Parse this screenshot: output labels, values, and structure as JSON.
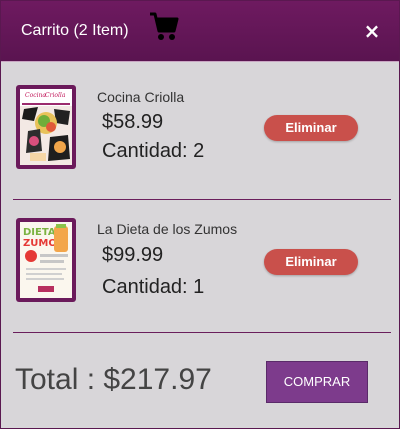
{
  "header": {
    "title": "Carrito (2 Item)",
    "cart_icon": "shopping-cart-icon",
    "close_icon": "close-icon",
    "close_glyph": "×"
  },
  "items": [
    {
      "name": "Cocina Criolla",
      "price": "$58.99",
      "quantity": "Cantidad: 2",
      "remove_label": "Eliminar",
      "cover": {
        "title_line_1": "Cocina",
        "title_line_2": "Criolla"
      }
    },
    {
      "name": "La Dieta de los Zumos",
      "price": "$99.99",
      "quantity": "Cantidad: 1",
      "remove_label": "Eliminar",
      "cover": {
        "title_line_1": "DIETA",
        "title_line_2": "ZUMOS"
      }
    }
  ],
  "footer": {
    "total_label": "Total : $217.97",
    "buy_label": "COMPRAR"
  },
  "colors": {
    "header": "#5a1450",
    "remove_button": "#c9504b",
    "buy_button": "#7d3b8c",
    "background": "#d8d6d9"
  }
}
